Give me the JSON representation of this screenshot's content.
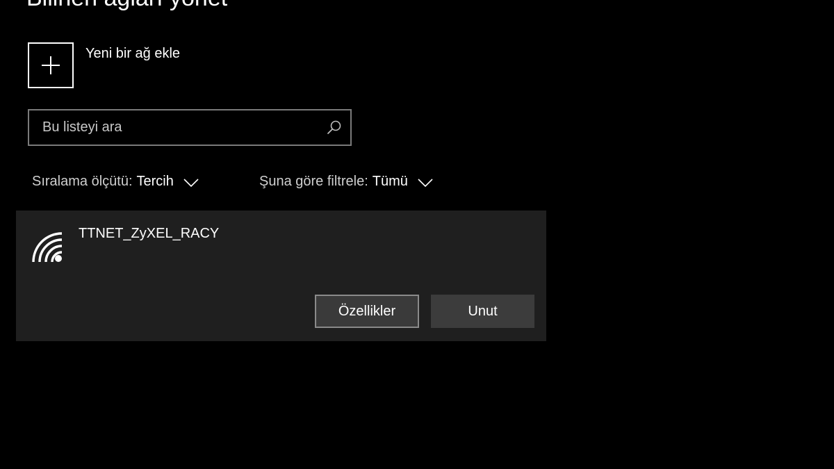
{
  "page": {
    "title": "Bilinen ağları yönet"
  },
  "add_network": {
    "label": "Yeni bir ağ ekle",
    "icon": "plus-icon"
  },
  "search": {
    "placeholder": "Bu listeyi ara",
    "value": "",
    "icon": "search-icon"
  },
  "sort": {
    "label": "Sıralama ölçütü:",
    "value": "Tercih"
  },
  "filter": {
    "label": "Şuna göre filtrele:",
    "value": "Tümü"
  },
  "networks": [
    {
      "name": "TTNET_ZyXEL_RACY",
      "icon": "wifi-icon",
      "properties_label": "Özellikler",
      "forget_label": "Unut"
    }
  ],
  "colors": {
    "background": "#000000",
    "card": "#1f1f1f",
    "button": "#3a3a3a",
    "text": "#ffffff"
  }
}
